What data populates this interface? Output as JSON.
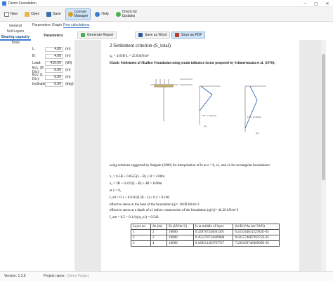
{
  "window": {
    "title": "Demo Foundation"
  },
  "toolbar": {
    "new": "New",
    "open": "Open",
    "save": "Save",
    "license_line1": "License",
    "license_line2": "Manager",
    "help": "Help",
    "update_line1": "Check for",
    "update_line2": "Updates"
  },
  "nav": {
    "general": "General",
    "soil_layers": "Soil Layers",
    "bearing_capacity": "Bearing capacity",
    "tools": "Tools"
  },
  "param_tabs": {
    "parameters": "Parameters",
    "graph": "Graph",
    "pow_calculations": "Pow calculations"
  },
  "params": {
    "header": "Parameters",
    "rows": [
      {
        "label": "L:",
        "value": "4.00",
        "unit": "(m)"
      },
      {
        "label": "B:",
        "value": "4.00",
        "unit": "(m)"
      },
      {
        "label": "Load:",
        "value": "410.00",
        "unit": "(kN)"
      },
      {
        "label": "Ecc. (B Dir.):",
        "value": "0.00",
        "unit": "(m)"
      },
      {
        "label": "Ecc. (L Dir.):",
        "value": "0.00",
        "unit": "(m)"
      },
      {
        "label": "Inclination:",
        "value": "0.00",
        "unit": "(deg)"
      }
    ]
  },
  "actions": {
    "generate": "Generate Report",
    "word": "Save as Word",
    "pdf": "Save as PDF"
  },
  "doc": {
    "heading": "2   Settlement criterion (S_total)",
    "q0": "q₀ = 410/B·L = 25.63kN/m²",
    "subheading": "Elastic Settlement of Shallow Foundation using strain influence factor proposed by Schmertmann et al. (1978):",
    "fig_labels": {
      "a": "(a)",
      "b": "(b)",
      "lb_hyp": "L/B = 1 (Square)",
      "lb_strip": "L/B ≥ 10 (Strip)"
    },
    "para1": "using relations suggested by Salgado (2008) for interpolation of Iz at z = 0, z1, and z2 for rectangular foundations:",
    "eq1": "z₁ = 0.5B + 0.0555(L - B) ≤ B = 2.00m",
    "eq2": "z₂ = 2B + 0.222(L - B) ≤ 4B = 8.00m",
    "eq3": "at z = 0,",
    "eq4": "I_z0 = 0.1 + 0.0111(L/B - 1) ≤ 0.2 = 0.100",
    "eq5": "effective stress at the base of the foundation (q)= 18.00 kN/m^2",
    "eq6": "effective stress at a depth of z1 before construction of the foundation (q(1))= 44.20 kN/m^2",
    "eq7": "I_zm = 0.5 + 0.1√(q/q_z1) = 0.542",
    "table": {
      "headers": [
        "Layer no",
        "Δz (m)",
        "Es (kN/m^2)",
        "Iz at middle of layer",
        "(Iz/Es)*Δz (m^3/kN)"
      ],
      "rows": [
        [
          "1",
          "2",
          "10000",
          "0.320767240561391",
          "6.41534481122782E-05"
        ],
        [
          "2",
          "2",
          "10000",
          "0.451278734369688",
          "9.02557468739375E-05"
        ],
        [
          "3",
          "4",
          "10000",
          "0.180511493707727",
          "7.22045974830906E-05"
        ]
      ]
    }
  },
  "status": {
    "version": "Version:  1.1.0",
    "project_label": "Project name:",
    "project_name": "Demo Project"
  }
}
